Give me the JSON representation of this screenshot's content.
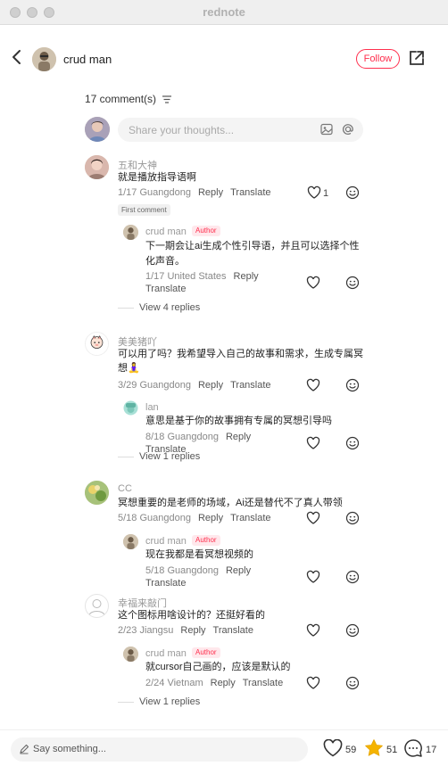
{
  "window": {
    "title": "rednote"
  },
  "header": {
    "author_name": "crud man",
    "follow_label": "Follow"
  },
  "comments_header": {
    "count_label": "17 comment(s)"
  },
  "input": {
    "placeholder": "Share your thoughts..."
  },
  "comments": [
    {
      "name": "五和大神",
      "text": "就是播放指导语啊",
      "date_loc": "1/17 Guangdong",
      "reply_label": "Reply",
      "translate_label": "Translate",
      "likes": "1",
      "badge": "First comment",
      "reply": {
        "name": "crud man",
        "badge": "Author",
        "text_line1": "下一期会让ai生成个性引导语，并且可以选择个性",
        "text_line2": "化声音。",
        "date_loc": "1/17 United States",
        "reply_label": "Reply",
        "translate_label": "Translate"
      },
      "view_replies": "View 4 replies"
    },
    {
      "name": "美美猪吖",
      "text_line1": "可以用了吗？我希望导入自己的故事和需求，生成专属冥",
      "text_line2": "想🧘‍♀️",
      "date_loc": "3/29 Guangdong",
      "reply_label": "Reply",
      "translate_label": "Translate",
      "reply": {
        "name": "lan",
        "text": "意思是基于你的故事拥有专属的冥想引导吗",
        "date_loc": "8/18 Guangdong",
        "reply_label": "Reply",
        "translate_label": "Translate"
      },
      "view_replies": "View 1 replies"
    },
    {
      "name": "CC",
      "text": "冥想重要的是老师的场域，Ai还是替代不了真人带领",
      "date_loc": "5/18 Guangdong",
      "reply_label": "Reply",
      "translate_label": "Translate",
      "reply": {
        "name": "crud man",
        "badge": "Author",
        "text": "现在我都是看冥想视频的",
        "date_loc": "5/18 Guangdong",
        "reply_label": "Reply",
        "translate_label": "Translate"
      }
    },
    {
      "name": "幸福来敲门",
      "text": "这个图标用啥设计的？还挺好看的",
      "date_loc": "2/23 Jiangsu",
      "reply_label": "Reply",
      "translate_label": "Translate",
      "reply": {
        "name": "crud man",
        "badge": "Author",
        "text": "就cursor自己画的，应该是默认的",
        "date_loc": "2/24 Vietnam",
        "reply_label": "Reply",
        "translate_label": "Translate"
      },
      "view_replies": "View 1 replies"
    }
  ],
  "bottom": {
    "say_placeholder": "Say something...",
    "likes": "59",
    "stars": "51",
    "comments": "17"
  },
  "colors": {
    "accent": "#ff2e4d",
    "star": "#f5b400"
  }
}
